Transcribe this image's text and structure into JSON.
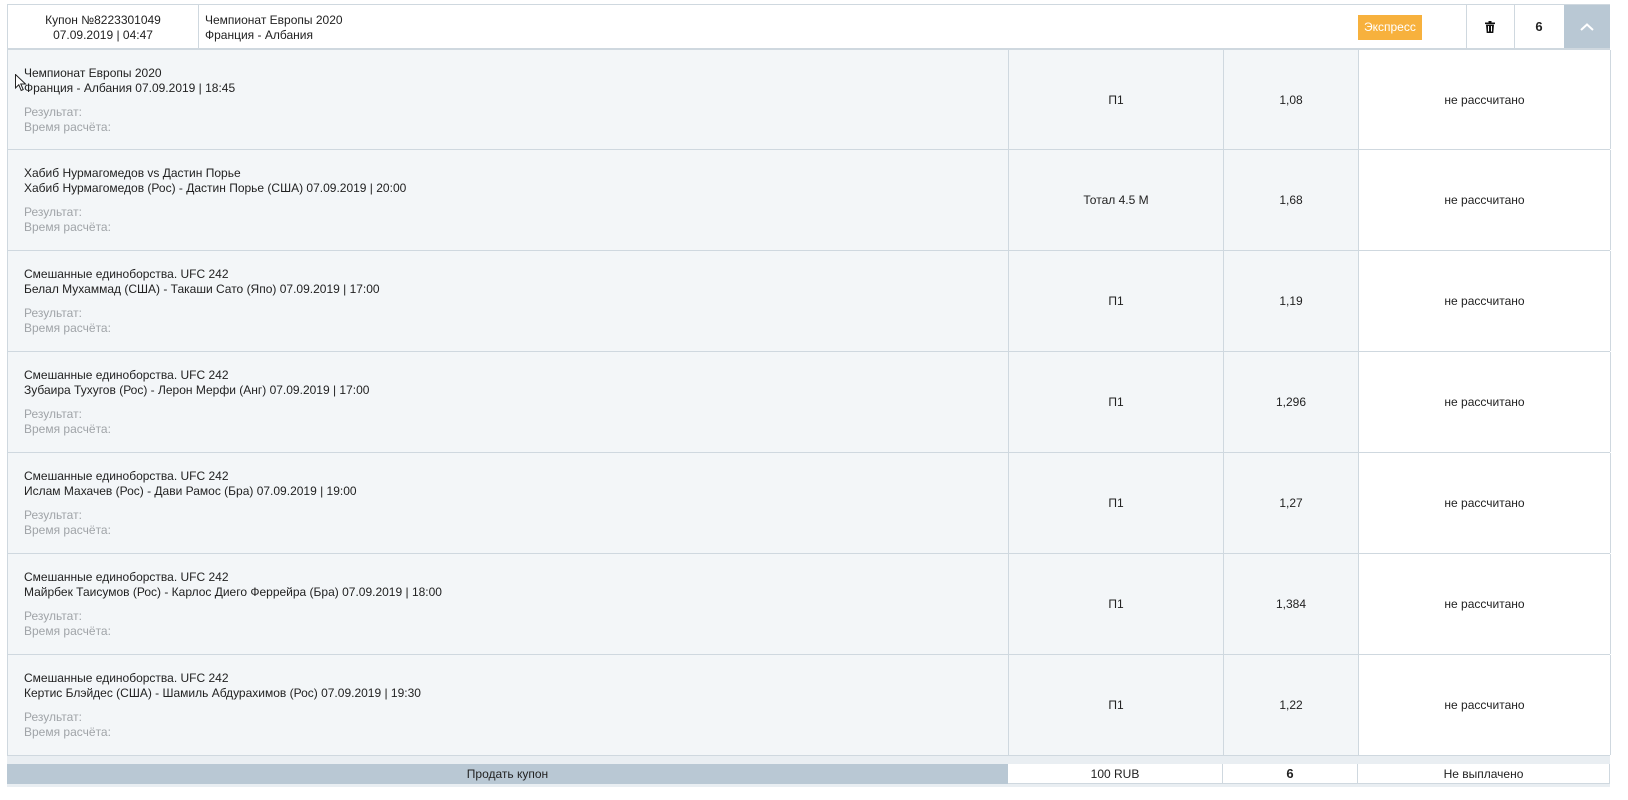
{
  "header": {
    "coupon_number": "Купон №8223301049",
    "coupon_datetime": "07.09.2019 | 04:47",
    "tournament": "Чемпионат Европы 2020",
    "match": "Франция - Албания",
    "type_badge": "Экспресс",
    "bets_count": "6",
    "delete_icon": "trash-icon",
    "collapse_icon": "chevron-up-icon"
  },
  "labels": {
    "result": "Результат:",
    "calc_time": "Время расчёта:"
  },
  "rows": [
    {
      "league": "Чемпионат Европы 2020",
      "event": "Франция - Албания 07.09.2019 | 18:45",
      "bet": "П1",
      "odds": "1,08",
      "status": "не рассчитано"
    },
    {
      "league": "Хабиб Нурмагомедов vs Дастин Порье",
      "event": "Хабиб Нурмагомедов (Рос) - Дастин Порье (США) 07.09.2019 | 20:00",
      "bet": "Тотал 4.5 М",
      "odds": "1,68",
      "status": "не рассчитано"
    },
    {
      "league": "Смешанные единоборства. UFC 242",
      "event": "Белал Мухаммад (США) - Такаши Сато (Япо) 07.09.2019 | 17:00",
      "bet": "П1",
      "odds": "1,19",
      "status": "не рассчитано"
    },
    {
      "league": "Смешанные единоборства. UFC 242",
      "event": "Зубаира Тухугов (Рос) - Лерон Мерфи (Анг) 07.09.2019 | 17:00",
      "bet": "П1",
      "odds": "1,296",
      "status": "не рассчитано"
    },
    {
      "league": "Смешанные единоборства. UFC 242",
      "event": "Ислам Махачев (Рос) - Дави Рамос (Бра) 07.09.2019 | 19:00",
      "bet": "П1",
      "odds": "1,27",
      "status": "не рассчитано"
    },
    {
      "league": "Смешанные единоборства. UFC 242",
      "event": "Майрбек Таисумов (Рос) - Карлос Диего Феррейра (Бра) 07.09.2019 | 18:00",
      "bet": "П1",
      "odds": "1,384",
      "status": "не рассчитано"
    },
    {
      "league": "Смешанные единоборства. UFC 242",
      "event": "Кертис Блэйдес (США) - Шамиль Абдурахимов (Рос) 07.09.2019 | 19:30",
      "bet": "П1",
      "odds": "1,22",
      "status": "не рассчитано"
    }
  ],
  "footer": {
    "sell_label": "Продать купон",
    "stake": "100 RUB",
    "total_odds": "6",
    "payout_status": "Не выплачено"
  },
  "colors": {
    "badge": "#f7b13d",
    "toggle_bg": "#b9c8d4",
    "row_bg": "#f3f6f8"
  }
}
